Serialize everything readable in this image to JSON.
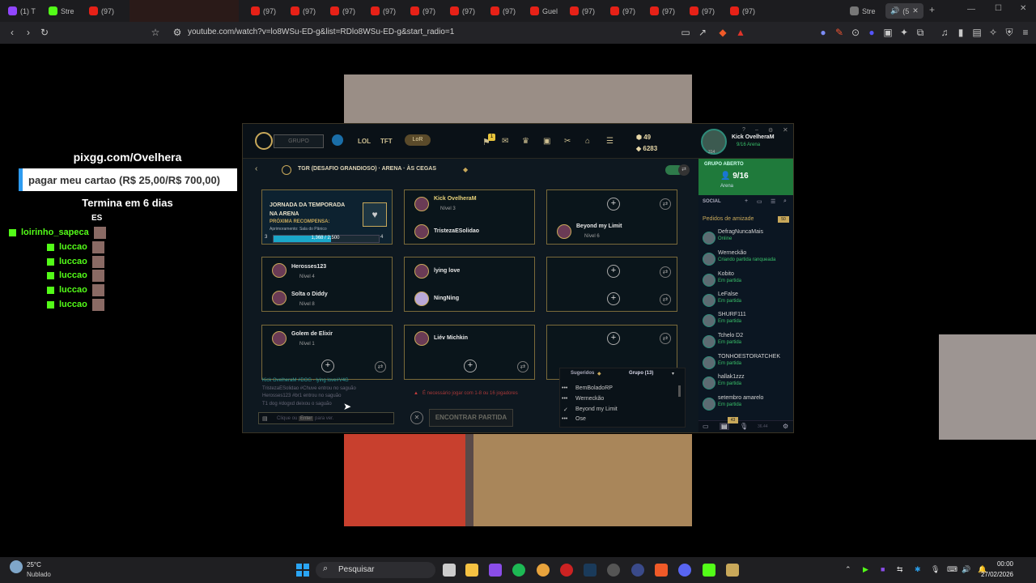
{
  "browser": {
    "tabs": [
      {
        "label": "(1) T",
        "icon": "twitch-icon"
      },
      {
        "label": "Stre",
        "icon": "kick-icon"
      },
      {
        "label": "(97)",
        "icon": "youtube-icon"
      },
      {
        "label": "(97)",
        "icon": "youtube-icon"
      },
      {
        "label": "(97)",
        "icon": "youtube-icon"
      },
      {
        "label": "(97)",
        "icon": "youtube-icon"
      },
      {
        "label": "(97)",
        "icon": "youtube-icon"
      },
      {
        "label": "(97)",
        "icon": "youtube-icon"
      },
      {
        "label": "(97)",
        "icon": "youtube-icon"
      },
      {
        "label": "(97)",
        "icon": "youtube-icon"
      },
      {
        "label": "Guel",
        "icon": "youtube-icon"
      },
      {
        "label": "(97)",
        "icon": "youtube-icon"
      },
      {
        "label": "(97)",
        "icon": "youtube-icon"
      },
      {
        "label": "(97)",
        "icon": "youtube-icon"
      },
      {
        "label": "(97)",
        "icon": "youtube-icon"
      },
      {
        "label": "(97)",
        "icon": "youtube-icon"
      },
      {
        "label": "Stre",
        "icon": "stream-icon"
      },
      {
        "label": "(5",
        "icon": "speaker-icon"
      }
    ],
    "url": "youtube.com/watch?v=lo8WSu-ED-g&list=RDlo8WSu-ED-g&start_radio=1"
  },
  "overlay": {
    "site": "pixgg.com/Ovelhera",
    "goal": "pagar meu cartao (R$ 25,00/R$ 700,00)",
    "ends": "Termina em 6 dias",
    "lang": "ES",
    "chat": [
      {
        "user": "loirinho_sapeca"
      },
      {
        "user": "luccao"
      },
      {
        "user": "luccao"
      },
      {
        "user": "luccao"
      },
      {
        "user": "luccao"
      },
      {
        "user": "luccao"
      }
    ]
  },
  "client": {
    "nav": {
      "grupo": "GRUPO",
      "lol": "LOL",
      "tft": "TFT",
      "lor": "LoR",
      "notif_count": "1"
    },
    "currency": {
      "rp": "49",
      "be": "6283"
    },
    "profile": {
      "name": "Kick OvelheraM",
      "status": "9/16 Arena",
      "level": "314"
    },
    "mode": "TGR (DESAFIO GRANDIOSO) · ARENA · ÀS CEGAS",
    "season": {
      "title": "JORNADA DA TEMPORADA NA ARENA",
      "reward_label": "PRÓXIMA RECOMPENSA:",
      "reward": "Aprimoramento: Sala do Pânico",
      "progress": "1,368 / 2,500",
      "progress_value": 0.547,
      "level_left": "3",
      "level_right": "4"
    },
    "slots": [
      {
        "name": "Kick OvelheraM",
        "level": "Nível 3"
      },
      {
        "name": "TristezaESolidao",
        "level": ""
      },
      {
        "name": "Beyond my Limit",
        "level": "Nível 6"
      },
      {
        "name": "Herosses123",
        "level": "Nível 4"
      },
      {
        "name": "Solta o Diddy",
        "level": "Nível 8"
      },
      {
        "name": "lying love",
        "level": ""
      },
      {
        "name": "NingNing",
        "level": ""
      },
      {
        "name": "Golem de Elixir",
        "level": "Nível 1"
      },
      {
        "name": "Liév Michkin",
        "level": ""
      }
    ],
    "chat_log": [
      "Kick OvelheraM #DOG - lying love#V4G",
      "TristezaESolidao #Chuve entrou no saguão",
      "Herosses123 #br1 entrou no saguão",
      "T1 dog #dogxd deixou o saguão"
    ],
    "chat_placeholder_pre": "Clique ou",
    "chat_placeholder_key": "Enter",
    "chat_placeholder_post": "para ver.",
    "warning": "É necessário jogar com 1-8 ou 16 jogadores",
    "find_match": "ENCONTRAR PARTIDA",
    "dropdown": {
      "tab1": "Sugeridos",
      "tab2": "Grupo (13)",
      "items": [
        "BemBoladoRP",
        "Werneckão",
        "Beyond my Limit",
        "Ose"
      ]
    },
    "social": {
      "group_title": "GRUPO ABERTO",
      "group_count": "9/16",
      "group_mode": "Arena",
      "title": "SOCIAL",
      "requests": "Pedidos de amizade",
      "requests_count": "50",
      "friends": [
        {
          "name": "DefragNuncaMais",
          "status": "Online"
        },
        {
          "name": "Werneckão",
          "status": "Criando partida ranqueada"
        },
        {
          "name": "Kobito",
          "status": "Em partida"
        },
        {
          "name": "LeFalse",
          "status": "Em partida"
        },
        {
          "name": "SHURF111",
          "status": "Em partida"
        },
        {
          "name": "Tchelo D2",
          "status": "Em partida"
        },
        {
          "name": "TONHOESTORATCHEK",
          "status": "Em partida"
        },
        {
          "name": "hallak1zzz",
          "status": "Em partida"
        },
        {
          "name": "setembro amarelo",
          "status": "Em partida"
        }
      ],
      "badge": "43",
      "version": "36.44"
    }
  },
  "taskbar": {
    "temp": "25°C",
    "weather": "Nublado",
    "search": "Pesquisar",
    "time": "00:00",
    "date": "27/02/2026"
  }
}
